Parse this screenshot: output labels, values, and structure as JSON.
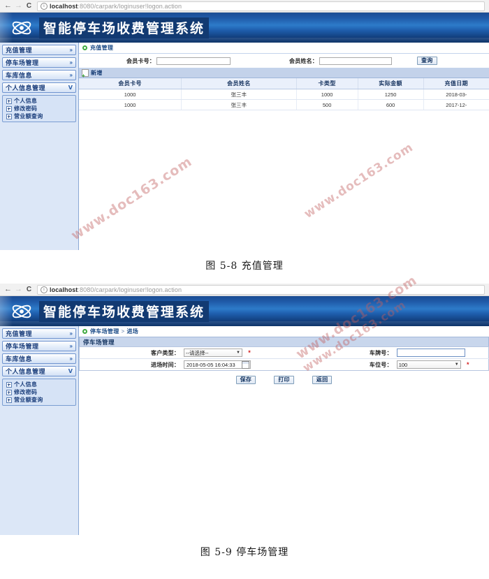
{
  "browser": {
    "back_icon": "back-arrow-icon",
    "forward_icon": "forward-arrow-icon",
    "reload_icon": "reload-icon",
    "info_glyph": "i",
    "url_host": "localhost",
    "url_path": ":8080/carpark/loginuser!logon.action"
  },
  "app": {
    "title": "智能停车场收费管理系统",
    "logo_icon": "atom-orbit-logo-icon"
  },
  "sidebar": {
    "menus": [
      {
        "label": "充值管理",
        "chevron": "»",
        "expanded": false
      },
      {
        "label": "停车场管理",
        "chevron": "»",
        "expanded": false
      },
      {
        "label": "车库信息",
        "chevron": "»",
        "expanded": false
      },
      {
        "label": "个人信息管理",
        "chevron": "ᐯ",
        "expanded": true
      }
    ],
    "submenu": [
      {
        "label": "个人信息"
      },
      {
        "label": "修改密码"
      },
      {
        "label": "营业额查询"
      }
    ]
  },
  "charge_page": {
    "breadcrumb": {
      "root": "充值管理"
    },
    "search": {
      "card_label": "会员卡号：",
      "card_value": "",
      "name_label": "会员姓名：",
      "name_value": "",
      "query_button": "查询"
    },
    "toolbar": {
      "add_label": "新增",
      "add_icon": "add-page-icon"
    },
    "table": {
      "columns": [
        "会员卡号",
        "会员姓名",
        "卡类型",
        "实际金额",
        "充值日期"
      ],
      "rows": [
        [
          "1000",
          "张三丰",
          "1000",
          "1250",
          "2018-03-"
        ],
        [
          "1000",
          "张三丰",
          "500",
          "600",
          "2017-12-"
        ]
      ]
    },
    "caption": "图 5-8 充值管理"
  },
  "park_page": {
    "breadcrumb": {
      "root": "停车场管理",
      "sep": ">",
      "leaf": "进场"
    },
    "panel_title": "停车场管理",
    "form": {
      "customer_type_label": "客户类型：",
      "customer_type_value": "--请选择--",
      "enter_time_label": "进场时间：",
      "enter_time_value": "2018-05-05 16:04:33",
      "plate_label": "车牌号：",
      "plate_value": "",
      "slot_label": "车位号：",
      "slot_value": "100",
      "required_mark": "*"
    },
    "actions": [
      {
        "label": "保存"
      },
      {
        "label": "打印"
      },
      {
        "label": "返回"
      }
    ],
    "caption": "图 5-9 停车场管理"
  },
  "watermark": {
    "text": "www.doc163.com"
  }
}
